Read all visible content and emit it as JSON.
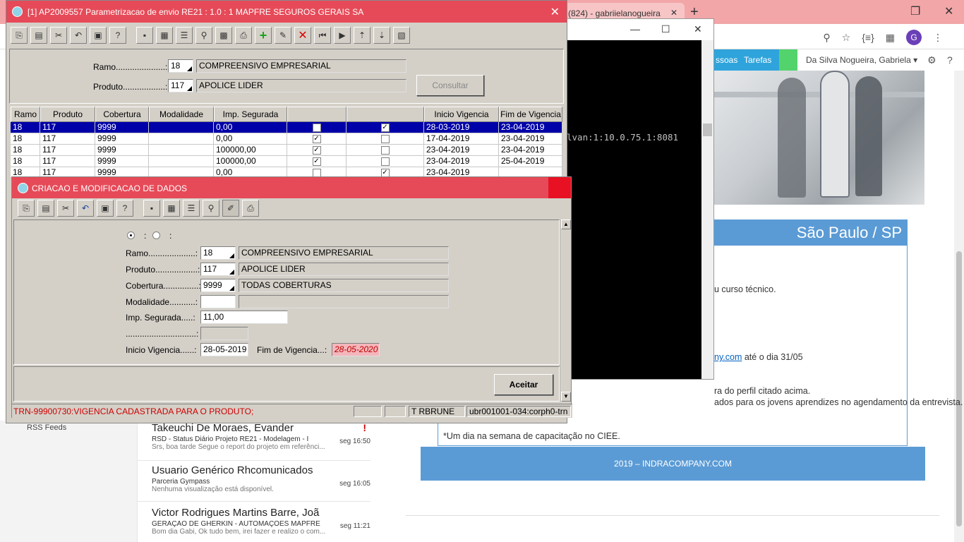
{
  "browser": {
    "tab_title": "(824) - gabriielanogueira",
    "site_nav": {
      "pessoas": "ssoas",
      "tarefas": "Tarefas"
    },
    "user_name": "Da Silva Nogueira, Gabriela",
    "avatar_letter": "G",
    "city": "São Paulo  / SP",
    "body_lines": [
      "u curso técnico.",
      "ny.com",
      " até o dia 31/05",
      "ra do perfil citado acima.",
      "ados para os jovens aprendizes no agendamento da entrevista.",
      "*Um dia na semana de capacitação no CIEE."
    ],
    "footer": "2019 – INDRACOMPANY.COM",
    "rss": "RSS Feeds",
    "mails": [
      {
        "sender": "Takeuchi De Moraes, Evander",
        "subject": "RSD - Status Diário Projeto RE21 - Modelagem - I",
        "preview": "Srs, boa tarde  Segue o report do projeto em referênci...",
        "time": "seg 16:50",
        "flag": "!"
      },
      {
        "sender": "Usuario Genérico Rhcomunicados",
        "subject": "Parceria Gympass",
        "preview": "Nenhuma visualização está disponível.",
        "time": "seg 16:05"
      },
      {
        "sender": "Victor Rodrigues Martins Barre, Joã",
        "subject": "GERAÇÃO DE GHERKIN - AUTOMAÇÕES MAPFRE",
        "preview": "Bom dia Gabi,  Ok tudo bem, irei fazer e realizo o com...",
        "time": "seg 11:21"
      }
    ]
  },
  "console": {
    "line": "lvan:1:10.0.75.1:8081"
  },
  "mainwin": {
    "title": "[1] AP2009557 Parametrizacao de envio RE21 :  1.0 : 1 MAPFRE SEGUROS GERAIS SA",
    "ramo_label": "Ramo.....................:",
    "ramo_code": "18",
    "ramo_desc": "COMPREENSIVO EMPRESARIAL",
    "produto_label": "Produto..................:",
    "produto_code": "117",
    "produto_desc": "APOLICE LIDER",
    "consultar": "Consultar",
    "columns": [
      "Ramo",
      "Produto",
      "Cobertura",
      "Modalidade",
      "Imp. Segurada",
      "",
      "",
      "Inicio Vigencia",
      "Fim de Vigencia"
    ],
    "rows": [
      {
        "ramo": "18",
        "produto": "117",
        "cobertura": "9999",
        "modalidade": "",
        "imp": "0,00",
        "c1": false,
        "c2": true,
        "inicio": "28-03-2019",
        "fim": "23-04-2019"
      },
      {
        "ramo": "18",
        "produto": "117",
        "cobertura": "9999",
        "modalidade": "",
        "imp": "0,00",
        "c1": true,
        "c2": false,
        "inicio": "17-04-2019",
        "fim": "23-04-2019"
      },
      {
        "ramo": "18",
        "produto": "117",
        "cobertura": "9999",
        "modalidade": "",
        "imp": "100000,00",
        "c1": true,
        "c2": false,
        "inicio": "23-04-2019",
        "fim": "23-04-2019"
      },
      {
        "ramo": "18",
        "produto": "117",
        "cobertura": "9999",
        "modalidade": "",
        "imp": "100000,00",
        "c1": true,
        "c2": false,
        "inicio": "23-04-2019",
        "fim": "25-04-2019"
      },
      {
        "ramo": "18",
        "produto": "117",
        "cobertura": "9999",
        "modalidade": "",
        "imp": "0,00",
        "c1": false,
        "c2": true,
        "inicio": "23-04-2019",
        "fim": ""
      }
    ]
  },
  "dialog": {
    "title": "CRIACAO E MODIFICACAO DE DADOS",
    "radio_sep": ":",
    "ramo_label": "Ramo....................:",
    "ramo_code": "18",
    "ramo_desc": "COMPREENSIVO EMPRESARIAL",
    "produto_label": "Produto..................:",
    "produto_code": "117",
    "produto_desc": "APOLICE LIDER",
    "cobertura_label": "Cobertura...............:",
    "cobertura_code": "9999",
    "cobertura_desc": "TODAS COBERTURAS",
    "modalidade_label": "Modalidade...........:",
    "imp_label": "Imp. Segurada.....:",
    "imp_value": "11,00",
    "blank_label": "..............................:",
    "inicio_label": "Inicio Vigencia......:",
    "inicio_value": "28-05-2019",
    "fim_label": "Fim de Vigencia...:",
    "fim_value": "28-05-2020",
    "aceitar": "Aceitar",
    "status_msg": "TRN-99900730:VIGENCIA CADASTRADA PARA O PRODUTO;",
    "status_user": "T  RBRUNE",
    "status_server": "ubr001001-034:corph0-trn"
  }
}
